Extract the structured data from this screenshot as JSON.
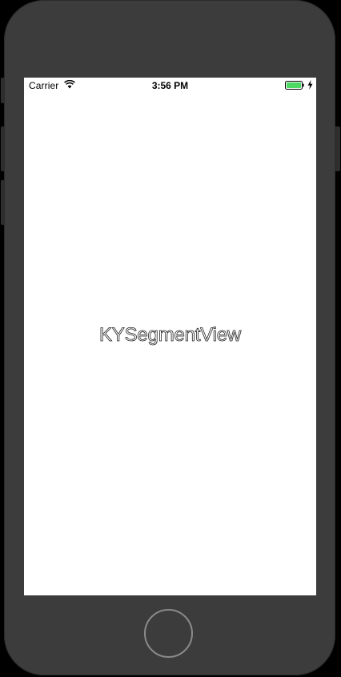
{
  "status_bar": {
    "carrier": "Carrier",
    "time": "3:56 PM",
    "wifi_icon": "wifi-icon",
    "battery_icon": "battery-charging-icon",
    "battery_color": "#4cd964"
  },
  "screen": {
    "title": "KYSegmentView"
  },
  "device": {
    "home_button_icon": "home-button",
    "body_color": "#3c3c3c"
  }
}
